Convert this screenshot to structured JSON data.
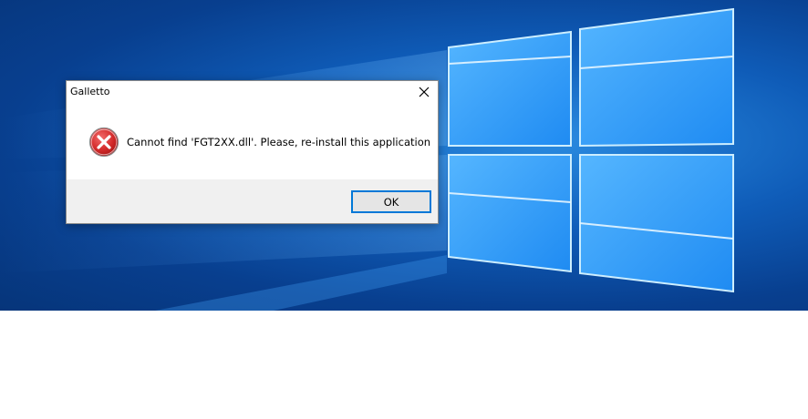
{
  "dialog": {
    "title": "Galletto",
    "message": "Cannot find 'FGT2XX.dll'. Please, re-install this application",
    "ok_label": "OK",
    "icon": "error-icon"
  },
  "colors": {
    "desktop_blue": "#0f5cb8",
    "button_border": "#0078d7",
    "error_red": "#d42b2b"
  }
}
